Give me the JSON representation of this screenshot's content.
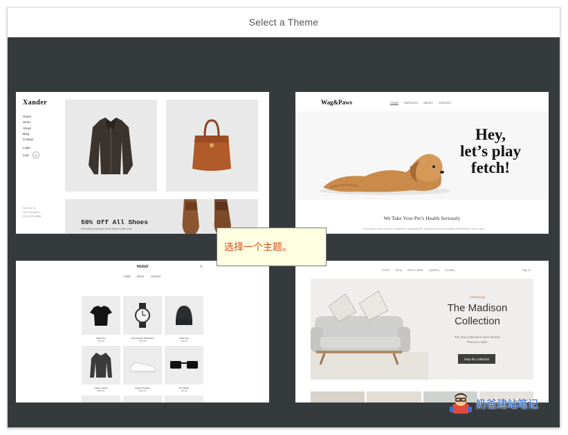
{
  "header": {
    "title": "Select a Theme"
  },
  "themes": {
    "xander": {
      "brand": "Xander",
      "nav": [
        "Home",
        "Store",
        "About",
        "Blog",
        "Contact"
      ],
      "login": "Login",
      "cart": "Cart",
      "cart_count": "0",
      "address_line1": "250 Ave St",
      "address_line2": "San Francisco",
      "phone": "(415) 872-5688",
      "promo": "50% Off All Shoes",
      "promo_sub": "Everything must go! Hurry before sales end."
    },
    "wagpaws": {
      "brand": "Wag&Paws",
      "nav": [
        "HOME",
        "SERVICES",
        "ABOUT",
        "CONTACT"
      ],
      "hero_line1": "Hey,",
      "hero_line2": "let’s play",
      "hero_line3": "fetch!",
      "tagline": "We Take Your Pet’s Health Seriously",
      "body": "Lorem ipsum dolor sit amet, consectetur adipiscing elit. Suspendisse iaculis facilisis condimentum. Donec quis"
    },
    "hugo": {
      "brand": "HUGO",
      "nav": [
        "HOME",
        "ABOUT",
        "CONTACT"
      ],
      "products": [
        {
          "name": "Black Tee",
          "price": "$35.00"
        },
        {
          "name": "Chronograph Wristwatch",
          "price": "$425.00"
        },
        {
          "name": "Wool Cap",
          "price": "$45.00"
        },
        {
          "name": "Leather Jacket",
          "price": "$385.00"
        },
        {
          "name": "Classic Sneaker",
          "price": "$120.00"
        },
        {
          "name": "The Shade",
          "price": "$95.00"
        }
      ]
    },
    "madison": {
      "nav": [
        "Home",
        "Shop",
        "Room Ideas",
        "Updates",
        "Contact"
      ],
      "account": "Sign In",
      "intro": "Introducing",
      "title_line1": "The Madison",
      "title_line2": "Collection",
      "desc_line1": "The new collections have arrived.",
      "desc_line2": "Find your style.",
      "cta": "Shop the Collection"
    }
  },
  "tooltip": {
    "text": "选择一个主题。"
  },
  "watermark": {
    "text": "奶爸建站笔记"
  }
}
